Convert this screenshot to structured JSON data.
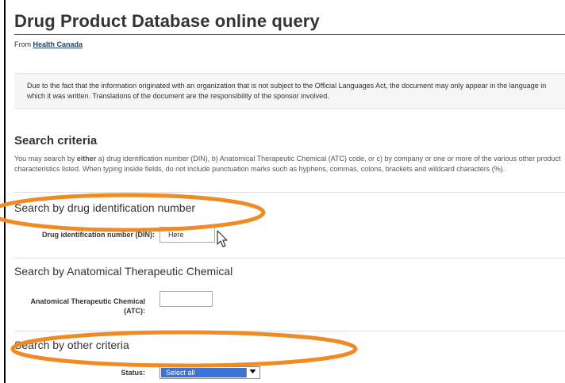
{
  "page": {
    "title": "Drug Product Database online query",
    "from_prefix": "From",
    "from_link": "Health Canada"
  },
  "notice": {
    "text": "Due to the fact that the information originated with an organization that is not subject to the Official Languages Act, the document may only appear in the language in which it was written. Translations of the document are the responsibility of the sponsor involved."
  },
  "search": {
    "heading": "Search criteria",
    "intro_before": "You may search by ",
    "intro_bold": "either",
    "intro_after": " a) drug identification number (DIN), b) Anatomical Therapeutic Chemical (ATC) code, or c) by company or one or more of the various other product characteristics listed. When typing inside fields, do not include punctuation marks such as hyphens, commas, colons, brackets and wildcard characters (%)."
  },
  "din_section": {
    "heading": "Search by drug identification number",
    "label": "Drug identification number (DIN):",
    "value": "Here"
  },
  "atc_section": {
    "heading": "Search by Anatomical Therapeutic Chemical",
    "label_line1": "Anatomical Therapeutic Chemical",
    "label_line2": "(ATC):",
    "value": ""
  },
  "other_section": {
    "heading": "Search by other criteria",
    "status_label": "Status:",
    "status_selected": "Select all"
  },
  "colors": {
    "title_rule": "#af3c43",
    "link": "#284162",
    "annotation": "#f08a24",
    "select_highlight": "#3b73d6"
  },
  "icons": {
    "cursor": "arrow-cursor-icon",
    "dropdown": "chevron-down-icon"
  }
}
